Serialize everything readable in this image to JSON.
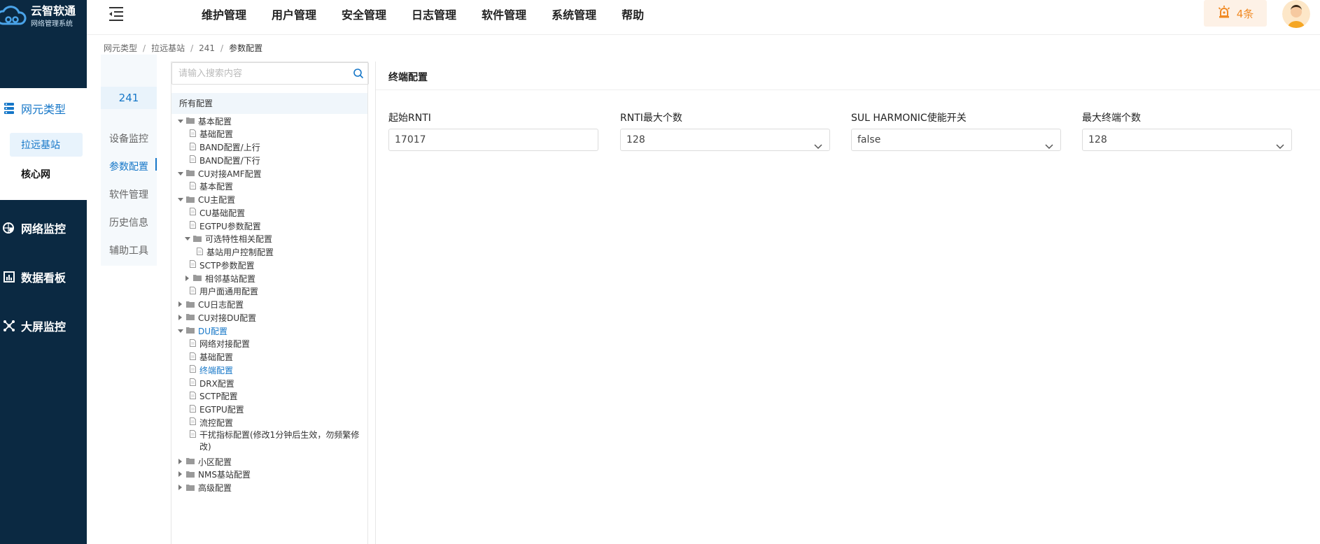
{
  "app": {
    "name": "云智软通",
    "subtitle": "网络管理系统"
  },
  "sidebar": {
    "items": [
      {
        "label": "网元类型",
        "icon": "server-icon",
        "active": true,
        "children": [
          {
            "label": "拉远基站",
            "active": true
          },
          {
            "label": "核心网",
            "active": false
          }
        ]
      },
      {
        "label": "网络监控",
        "icon": "network-monitor-icon"
      },
      {
        "label": "数据看板",
        "icon": "chart-icon"
      },
      {
        "label": "大屏监控",
        "icon": "screen-monitor-icon"
      }
    ]
  },
  "header": {
    "nav": [
      "维护管理",
      "用户管理",
      "安全管理",
      "日志管理",
      "软件管理",
      "系统管理",
      "帮助"
    ],
    "alarm_count": "4条",
    "colors": {
      "accent": "#1677c8",
      "alarm": "#f08a24",
      "sidebar": "#0b2942"
    }
  },
  "breadcrumb": [
    "网元类型",
    "拉远基站",
    "241",
    "参数配置"
  ],
  "ne_panel": {
    "id": "241",
    "tabs": [
      {
        "label": "设备监控",
        "active": false
      },
      {
        "label": "参数配置",
        "active": true
      },
      {
        "label": "软件管理",
        "active": false
      },
      {
        "label": "历史信息",
        "active": false
      },
      {
        "label": "辅助工具",
        "active": false
      }
    ]
  },
  "tree": {
    "search_placeholder": "请输入搜索内容",
    "header": "所有配置",
    "rows": [
      {
        "label": "基本配置",
        "type": "folder",
        "expanded": true,
        "level": 0
      },
      {
        "label": "基础配置",
        "type": "file",
        "level": 1
      },
      {
        "label": "BAND配置/上行",
        "type": "file",
        "level": 1
      },
      {
        "label": "BAND配置/下行",
        "type": "file",
        "level": 1
      },
      {
        "label": "CU对接AMF配置",
        "type": "folder",
        "expanded": true,
        "level": 0
      },
      {
        "label": "基本配置",
        "type": "file",
        "level": 1
      },
      {
        "label": "CU主配置",
        "type": "folder",
        "expanded": true,
        "level": 0
      },
      {
        "label": "CU基础配置",
        "type": "file",
        "level": 1
      },
      {
        "label": "EGTPU参数配置",
        "type": "file",
        "level": 1
      },
      {
        "label": "可选特性相关配置",
        "type": "folder",
        "expanded": true,
        "level": 1
      },
      {
        "label": "基站用户控制配置",
        "type": "file",
        "level": 2
      },
      {
        "label": "SCTP参数配置",
        "type": "file",
        "level": 1
      },
      {
        "label": "相邻基站配置",
        "type": "folder",
        "expanded": false,
        "level": 1
      },
      {
        "label": "用户面通用配置",
        "type": "file",
        "level": 1
      },
      {
        "label": "CU日志配置",
        "type": "folder",
        "expanded": false,
        "level": 0
      },
      {
        "label": "CU对接DU配置",
        "type": "folder",
        "expanded": false,
        "level": 0
      },
      {
        "label": "DU配置",
        "type": "folder",
        "expanded": true,
        "level": 0,
        "active": true
      },
      {
        "label": "网络对接配置",
        "type": "file",
        "level": 1
      },
      {
        "label": "基础配置",
        "type": "file",
        "level": 1
      },
      {
        "label": "终端配置",
        "type": "file",
        "level": 1,
        "active": true
      },
      {
        "label": "DRX配置",
        "type": "file",
        "level": 1
      },
      {
        "label": "SCTP配置",
        "type": "file",
        "level": 1
      },
      {
        "label": "EGTPU配置",
        "type": "file",
        "level": 1
      },
      {
        "label": "流控配置",
        "type": "file",
        "level": 1
      },
      {
        "label": "干扰指标配置(修改1分钟后生效，勿频繁修改)",
        "type": "file",
        "level": 1
      },
      {
        "label": "小区配置",
        "type": "folder",
        "expanded": false,
        "level": 0
      },
      {
        "label": "NMS基站配置",
        "type": "folder",
        "expanded": false,
        "level": 0
      },
      {
        "label": "高级配置",
        "type": "folder",
        "expanded": false,
        "level": 0
      }
    ]
  },
  "content": {
    "title": "终端配置",
    "fields": [
      {
        "label": "起始RNTI",
        "value": "17017",
        "kind": "input"
      },
      {
        "label": "RNTI最大个数",
        "value": "128",
        "kind": "select"
      },
      {
        "label": "SUL HARMONIC使能开关",
        "value": "false",
        "kind": "select"
      },
      {
        "label": "最大终端个数",
        "value": "128",
        "kind": "select"
      }
    ]
  }
}
